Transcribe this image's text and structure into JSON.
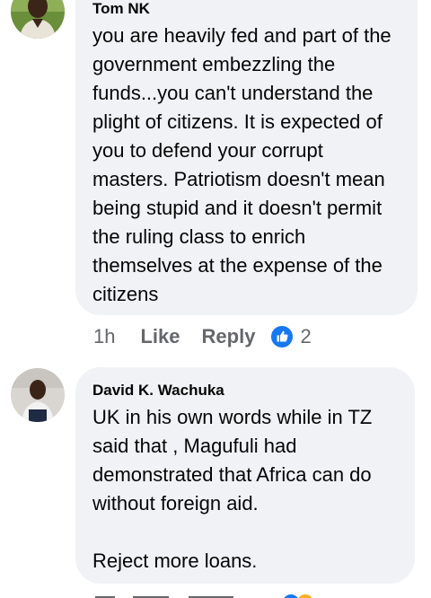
{
  "comments": [
    {
      "author": "Tom NK",
      "text": "you are heavily fed and part of the government embezzling the funds...you can't understand the plight of citizens. It is expected of you to defend your corrupt masters. Patriotism doesn't mean being stupid and it doesn't permit the ruling class to enrich themselves at the expense of the citizens",
      "time": "1h",
      "like_label": "Like",
      "reply_label": "Reply",
      "reaction_count": "2",
      "reaction_icon": "like-icon"
    },
    {
      "author": "David K. Wachuka",
      "text": "UK in his own words while in TZ said that , Magufuli had demonstrated that Africa can do without foreign aid.\n\nReject more loans."
    }
  ],
  "colors": {
    "bubble": "#f0f2f5",
    "action_text": "#65676b",
    "like_blue": "#1877f2",
    "text": "#050505"
  }
}
